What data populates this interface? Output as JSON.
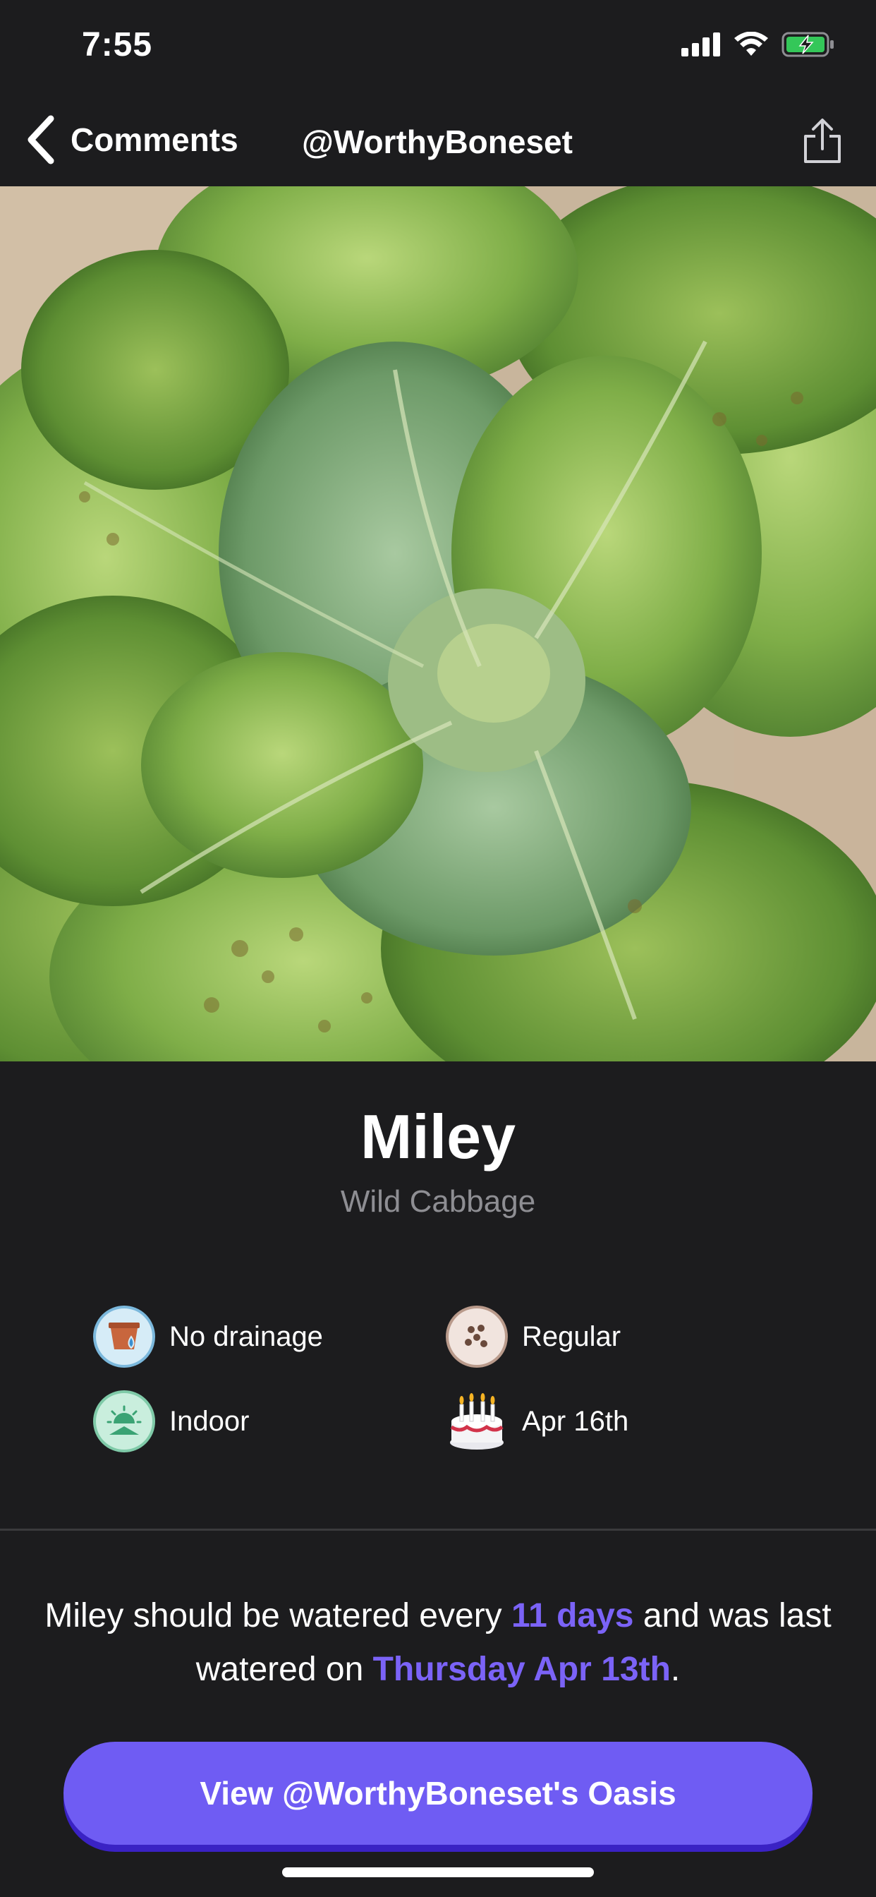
{
  "status_bar": {
    "time": "7:55"
  },
  "nav": {
    "back_label": "Comments",
    "title": "@WorthyBoneset"
  },
  "plant": {
    "name": "Miley",
    "species": "Wild Cabbage",
    "attributes": [
      {
        "label": "No drainage",
        "icon": "pot-icon"
      },
      {
        "label": "Regular",
        "icon": "soil-icon"
      },
      {
        "label": "Indoor",
        "icon": "indoor-sun-icon"
      },
      {
        "label": "Apr 16th",
        "icon": "birthday-cake-icon"
      }
    ]
  },
  "watering": {
    "part1": "Miley should be watered every ",
    "interval": "11 days",
    "part2": " and was last watered on ",
    "last_watered": "Thursday Apr 13th",
    "part3": "."
  },
  "action": {
    "label": "View @WorthyBoneset's Oasis"
  },
  "colors": {
    "accent": "#6f5cf3",
    "highlight": "#7b63f7",
    "background": "#1c1c1e"
  }
}
